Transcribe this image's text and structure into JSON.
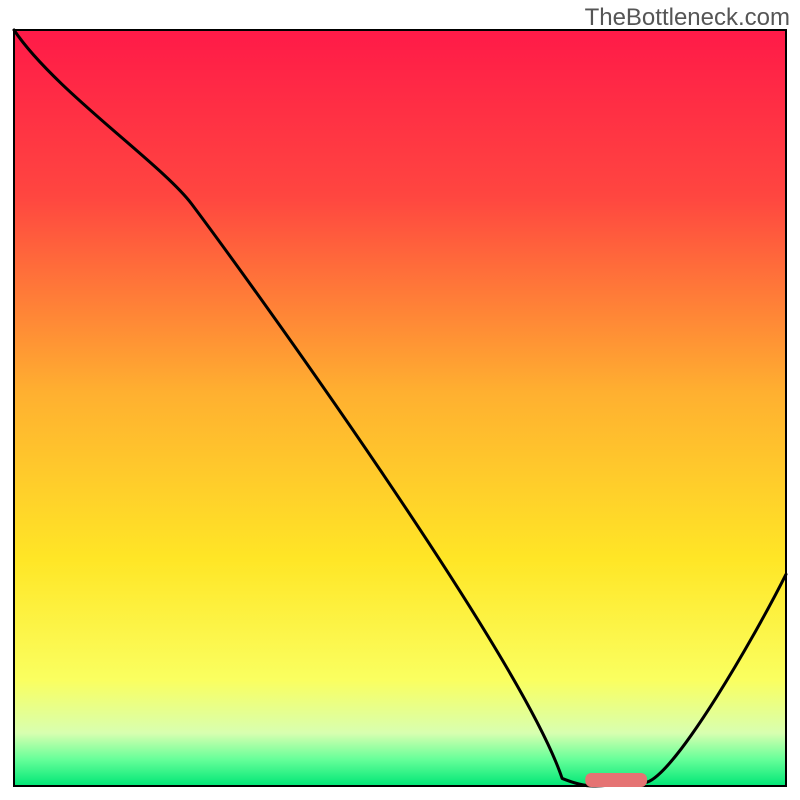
{
  "watermark": "TheBottleneck.com",
  "chart_data": {
    "type": "line",
    "title": "",
    "xlabel": "",
    "ylabel": "",
    "xlim": [
      0,
      100
    ],
    "ylim": [
      0,
      100
    ],
    "x": [
      0,
      23,
      71,
      75,
      82,
      100
    ],
    "y": [
      100,
      77,
      1,
      0,
      0.5,
      28
    ],
    "optimal_marker": {
      "x_start": 74,
      "x_end": 82,
      "y": 0.8
    },
    "background": "gradient-red-yellow-green",
    "gradient_stops": [
      {
        "pos": 0.0,
        "color": "#ff1a48"
      },
      {
        "pos": 0.22,
        "color": "#ff4640"
      },
      {
        "pos": 0.48,
        "color": "#ffb030"
      },
      {
        "pos": 0.7,
        "color": "#ffe626"
      },
      {
        "pos": 0.86,
        "color": "#faff60"
      },
      {
        "pos": 0.93,
        "color": "#d8ffb0"
      },
      {
        "pos": 0.965,
        "color": "#66ff99"
      },
      {
        "pos": 1.0,
        "color": "#00e676"
      }
    ],
    "annotations": []
  }
}
